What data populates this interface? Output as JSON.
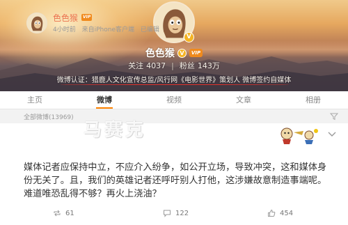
{
  "profile": {
    "nickname": "色色猴",
    "follow_label": "关注",
    "follow_count": "4037",
    "fans_label": "粉丝",
    "fans_count": "143万",
    "stats_separator": "|",
    "vip_badge": "VIP",
    "certification": "微博认证：猎鹿人文化宣传总监/风行网《电影世界》策划人 微博签约自媒体"
  },
  "tabs": [
    {
      "label": "主页"
    },
    {
      "label": "微博"
    },
    {
      "label": "视频"
    },
    {
      "label": "文章"
    },
    {
      "label": "相册"
    }
  ],
  "feed": {
    "count_label": "全部微博(13969)"
  },
  "post": {
    "author": "色色猴",
    "time": "4小时前",
    "source": "来自iPhone客户端",
    "edited": "已编辑",
    "text": "媒体记者应保持中立，不应介入纷争，如公开立场，导致冲突，这和媒体身份无关了。且，我们的英雄记者还呼吁别人打他，这涉嫌故意制造事端呢。难道唯恐乱得不够？再火上浇油？",
    "reposts": "61",
    "comments": "122",
    "likes": "454"
  },
  "watermark": "马赛克",
  "colors": {
    "accent": "#ff8200",
    "name_orange": "#eb7350",
    "underline_red": "#e0322b"
  }
}
